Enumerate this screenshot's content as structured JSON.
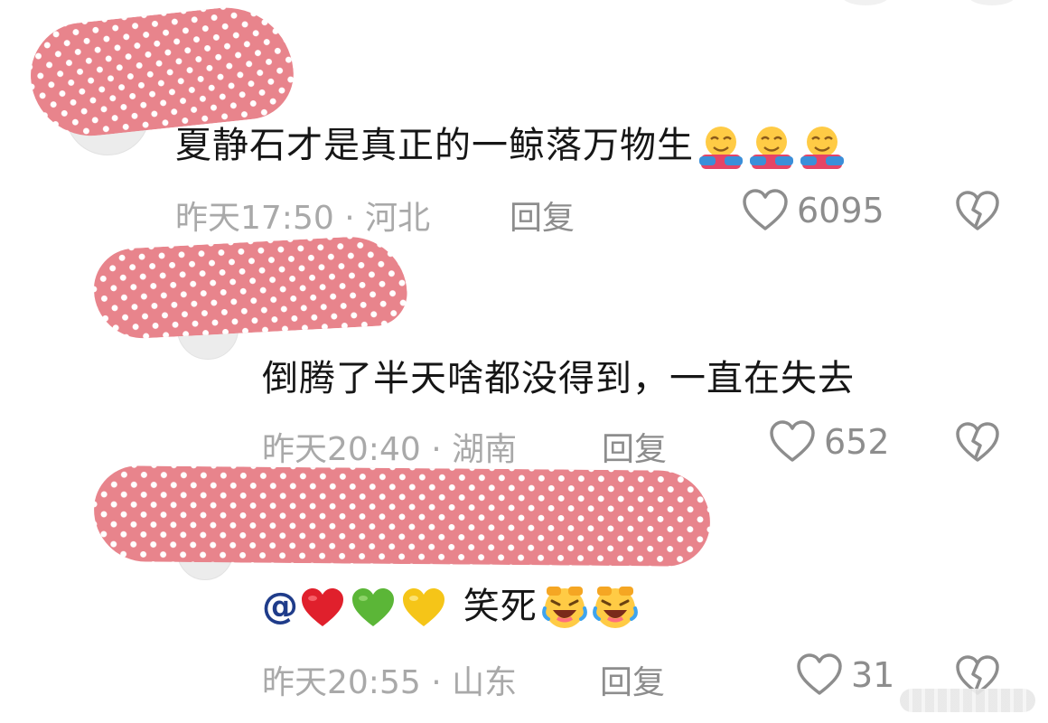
{
  "comments": [
    {
      "text": "夏静石才是真正的一鲸落万物生",
      "emoji": "hugging-face",
      "time_location": "昨天17:50 · 河北",
      "reply_label": "回复",
      "likes": "6095"
    },
    {
      "text": "倒腾了半天啥都没得到，一直在失去",
      "time_location": "昨天20:40 · 湖南",
      "reply_label": "回复",
      "likes": "652"
    },
    {
      "mention": "@",
      "text": "笑死",
      "emoji": "rolling-laughing-face",
      "time_location": "昨天20:55 · 山东",
      "reply_label": "回复",
      "likes": "31"
    }
  ],
  "colors": {
    "redaction": "#e8848c",
    "text_primary": "#161616",
    "text_secondary": "#a9a9a9",
    "icon_gray": "#8d8d8d",
    "mention_blue": "#1f3c8a"
  }
}
